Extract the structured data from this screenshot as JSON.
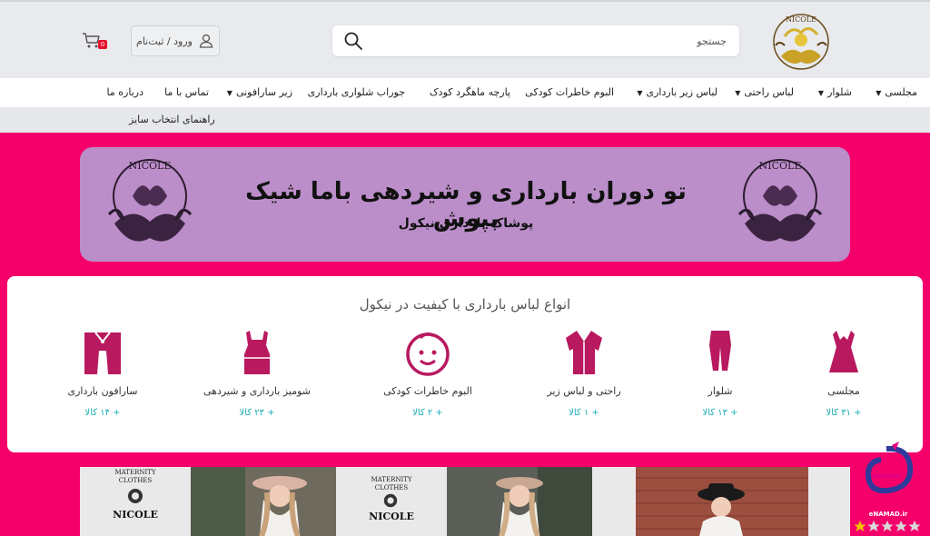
{
  "header": {
    "search_placeholder": "جستجو",
    "login_label": "ورود / ثبت‌نام",
    "cart_count": "0",
    "logo_text": "NICOLE"
  },
  "nav": {
    "items": [
      {
        "label": "مجلسی",
        "dropdown": true
      },
      {
        "label": "شلوار",
        "dropdown": true
      },
      {
        "label": "لباس راحتی",
        "dropdown": true
      },
      {
        "label": "لباس زیر بارداری",
        "dropdown": true
      },
      {
        "label": "البوم خاطرات کودکی",
        "dropdown": false
      },
      {
        "label": "پارچه ماهگرد کودک",
        "dropdown": false
      },
      {
        "label": "جوراب شلواری بارداری",
        "dropdown": false
      },
      {
        "label": "زیر سارافونی",
        "dropdown": true
      },
      {
        "label": "تماس با ما",
        "dropdown": false
      },
      {
        "label": "درباره ما",
        "dropdown": false
      }
    ],
    "secondary": "راهنمای انتخاب سایز"
  },
  "banner": {
    "title": "تو دوران بارداری و شیردهی باما شیک بپوش",
    "subtitle": "پوشاک بارداری نیکول"
  },
  "categories": {
    "heading": "انواع لباس بارداری با کیفیت در نیکول",
    "items": [
      {
        "label": "مجلسی",
        "count": "+ ۳۱ کالا",
        "icon": "dress-icon"
      },
      {
        "label": "شلوار",
        "count": "+ ۱۳ کالا",
        "icon": "pants-icon"
      },
      {
        "label": "راحتی و لباس زیر",
        "count": "+ ۱ کالا",
        "icon": "robe-icon"
      },
      {
        "label": "البوم خاطرات کودکی",
        "count": "+ ۲ کالا",
        "icon": "baby-face-icon"
      },
      {
        "label": "شومیز بارداری و شیردهی",
        "count": "+ ۲۳ کالا",
        "icon": "blouse-icon"
      },
      {
        "label": "سارافون بارداری",
        "count": "+ ۱۴ کالا",
        "icon": "overall-icon"
      }
    ]
  },
  "products": {
    "brand_line1": "MATERNITY",
    "brand_line2": "CLOTHES",
    "brand_name": "NICOLE"
  },
  "enamad": {
    "label": "eNAMAD.ir"
  },
  "colors": {
    "brand_pink": "#f5006b",
    "category_icon": "#b8195f",
    "banner_purple": "#bb8ec9",
    "count_teal": "#1aaeb5"
  }
}
